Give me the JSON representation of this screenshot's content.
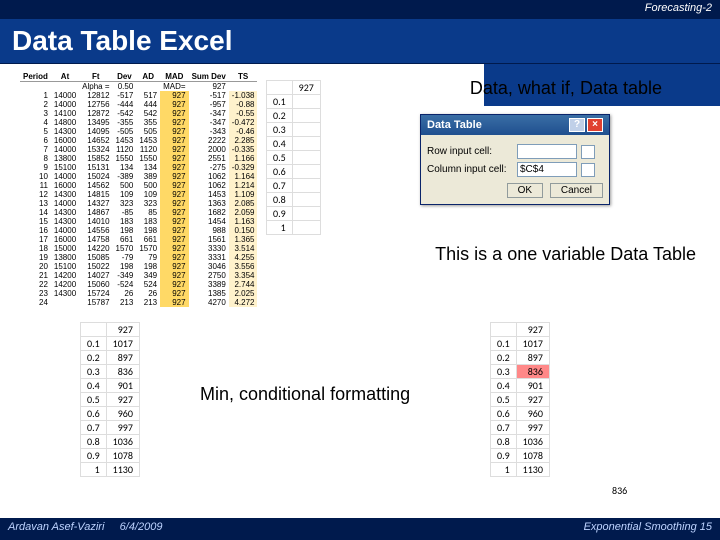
{
  "topbar": "Forecasting-2",
  "title": "Data  Table Excel",
  "main_table": {
    "headers": [
      "Period",
      "At",
      "Ft",
      "Dev",
      "AD",
      "MAD",
      "Sum Dev",
      "TS"
    ],
    "alpha_label": "Alpha =",
    "alpha_val": "0.50",
    "mad_label": "MAD=",
    "mad_val": "927",
    "rows": [
      [
        "1",
        "14000",
        "12812",
        "-517",
        "517",
        "927",
        "-517",
        "-1.038"
      ],
      [
        "2",
        "14000",
        "12756",
        "-444",
        "444",
        "927",
        "-957",
        "-0.88"
      ],
      [
        "3",
        "14100",
        "12872",
        "-542",
        "542",
        "927",
        "-347",
        "-0.55"
      ],
      [
        "4",
        "14800",
        "13495",
        "-355",
        "355",
        "927",
        "-347",
        "-0.472"
      ],
      [
        "5",
        "14300",
        "14095",
        "-505",
        "505",
        "927",
        "-343",
        "-0.46"
      ],
      [
        "6",
        "16000",
        "14652",
        "1453",
        "1453",
        "927",
        "2222",
        "2.285"
      ],
      [
        "7",
        "14000",
        "15324",
        "1120",
        "1120",
        "927",
        "2000",
        "-0.335"
      ],
      [
        "8",
        "13800",
        "15852",
        "1550",
        "1550",
        "927",
        "2551",
        "1.166"
      ],
      [
        "9",
        "15100",
        "15131",
        "134",
        "134",
        "927",
        "-275",
        "-0.329"
      ],
      [
        "10",
        "14000",
        "15024",
        "-389",
        "389",
        "927",
        "1062",
        "1.164"
      ],
      [
        "11",
        "16000",
        "14562",
        "500",
        "500",
        "927",
        "1062",
        "1.214"
      ],
      [
        "12",
        "14300",
        "14815",
        "109",
        "109",
        "927",
        "1453",
        "1.109"
      ],
      [
        "13",
        "14000",
        "14327",
        "323",
        "323",
        "927",
        "1363",
        "2.085"
      ],
      [
        "14",
        "14300",
        "14867",
        "-85",
        "85",
        "927",
        "1682",
        "2.059"
      ],
      [
        "15",
        "14300",
        "14010",
        "183",
        "183",
        "927",
        "1454",
        "1.163"
      ],
      [
        "16",
        "14000",
        "14556",
        "198",
        "198",
        "927",
        "988",
        "0.150"
      ],
      [
        "17",
        "16000",
        "14758",
        "661",
        "661",
        "927",
        "1561",
        "1.365"
      ],
      [
        "18",
        "15000",
        "14220",
        "1570",
        "1570",
        "927",
        "3330",
        "3.514"
      ],
      [
        "19",
        "13800",
        "15085",
        "-79",
        "79",
        "927",
        "3331",
        "4.255"
      ],
      [
        "20",
        "15100",
        "15022",
        "198",
        "198",
        "927",
        "3046",
        "3.556"
      ],
      [
        "21",
        "14200",
        "14027",
        "-349",
        "349",
        "927",
        "2750",
        "3.354"
      ],
      [
        "22",
        "14200",
        "15060",
        "-524",
        "524",
        "927",
        "3389",
        "2.744"
      ],
      [
        "23",
        "14300",
        "15724",
        "26",
        "26",
        "927",
        "1385",
        "2.025"
      ],
      [
        "24",
        "",
        "15787",
        "213",
        "213",
        "927",
        "4270",
        "4.272"
      ]
    ]
  },
  "alpha_small_top": {
    "header_val": "927",
    "rows": [
      "0.1",
      "0.2",
      "0.3",
      "0.4",
      "0.5",
      "0.6",
      "0.7",
      "0.8",
      "0.9",
      "1"
    ]
  },
  "caption1": "Data, what if, Data table",
  "caption2": "This is a one variable Data Table",
  "caption3": "Min, conditional formatting",
  "alpha_results": {
    "header_val": "927",
    "rows": [
      [
        "0.1",
        "1017"
      ],
      [
        "0.2",
        "897"
      ],
      [
        "0.3",
        "836"
      ],
      [
        "0.4",
        "901"
      ],
      [
        "0.5",
        "927"
      ],
      [
        "0.6",
        "960"
      ],
      [
        "0.7",
        "997"
      ],
      [
        "0.8",
        "1036"
      ],
      [
        "0.9",
        "1078"
      ],
      [
        "1",
        "1130"
      ]
    ]
  },
  "alpha_results2": {
    "header_val": "927",
    "rows": [
      [
        "0.1",
        "1017"
      ],
      [
        "0.2",
        "897"
      ],
      [
        "0.3",
        "836"
      ],
      [
        "0.4",
        "901"
      ],
      [
        "0.5",
        "927"
      ],
      [
        "0.6",
        "960"
      ],
      [
        "0.7",
        "997"
      ],
      [
        "0.8",
        "1036"
      ],
      [
        "0.9",
        "1078"
      ],
      [
        "1",
        "1130"
      ]
    ],
    "hl_row": 2,
    "min_val": "836"
  },
  "dialog": {
    "title": "Data Table",
    "row_label": "Row input cell:",
    "col_label": "Column input cell:",
    "col_val": "$C$4",
    "ok": "OK",
    "cancel": "Cancel",
    "help_icon": "?",
    "close_icon": "×"
  },
  "footer": {
    "author": "Ardavan Asef-Vaziri",
    "date": "6/4/2009",
    "right": "Exponential Smoothing  15"
  }
}
